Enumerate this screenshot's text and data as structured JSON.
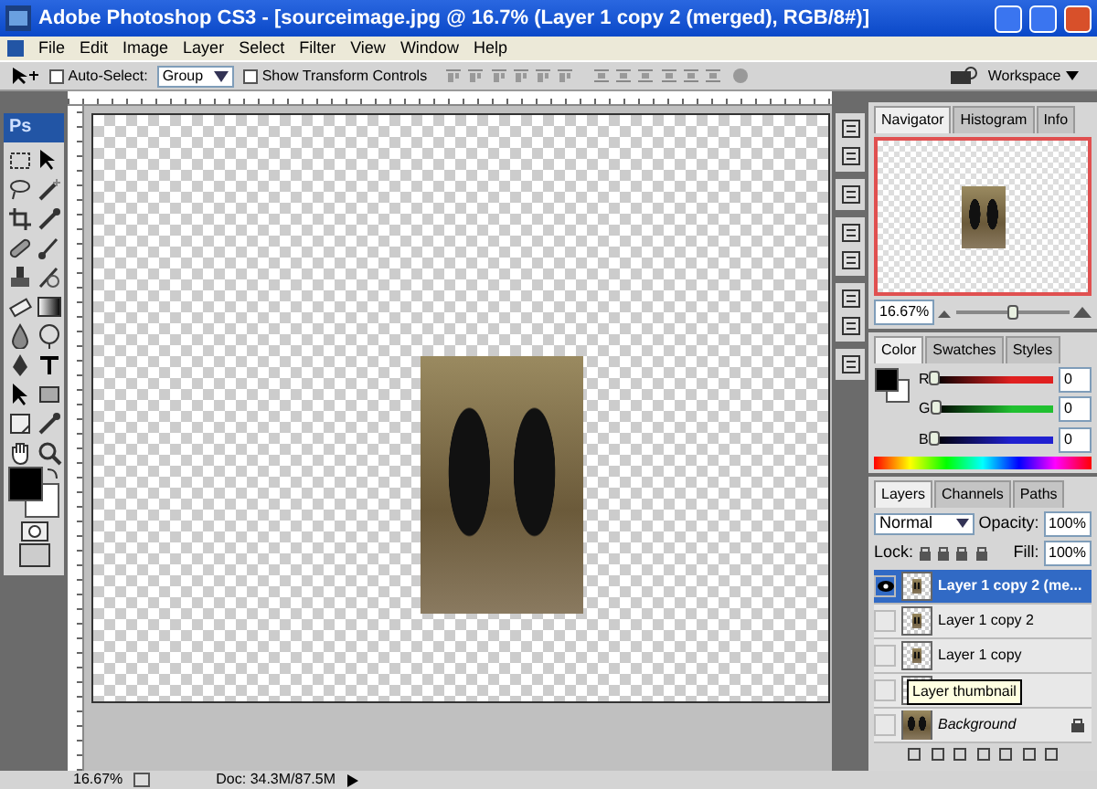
{
  "window": {
    "title": "Adobe Photoshop CS3 - [sourceimage.jpg @ 16.7% (Layer 1 copy 2 (merged), RGB/8#)]"
  },
  "menu": [
    "File",
    "Edit",
    "Image",
    "Layer",
    "Select",
    "Filter",
    "View",
    "Window",
    "Help"
  ],
  "options_bar": {
    "auto_select": {
      "label": "Auto-Select:",
      "checked": false
    },
    "auto_select_mode": "Group",
    "transform_controls": {
      "label": "Show Transform Controls",
      "checked": false
    },
    "workspace": "Workspace"
  },
  "toolbox": {
    "logo": "Ps"
  },
  "navigator": {
    "tabs": [
      {
        "label": "Navigator",
        "selected": true
      },
      {
        "label": "Histogram",
        "selected": false
      },
      {
        "label": "Info",
        "selected": false
      }
    ],
    "zoom": "16.67%",
    "level": 0.5
  },
  "color": {
    "tabs": [
      {
        "label": "Color",
        "selected": true
      },
      {
        "label": "Swatches",
        "selected": false
      },
      {
        "label": "Styles",
        "selected": false
      }
    ],
    "channels": [
      {
        "name": "R",
        "value": "0",
        "level": 0,
        "color": "#e02020"
      },
      {
        "name": "G",
        "value": "0",
        "level": 0,
        "color": "#20c030"
      },
      {
        "name": "B",
        "value": "0",
        "level": 0,
        "color": "#2020d0"
      }
    ]
  },
  "layers": {
    "tabs": [
      {
        "label": "Layers",
        "selected": true
      },
      {
        "label": "Channels",
        "selected": false
      },
      {
        "label": "Paths",
        "selected": false
      }
    ],
    "blend_mode": "Normal",
    "opacity_label": "Opacity:",
    "opacity": "100%",
    "lock_label": "Lock:",
    "fill_label": "Fill:",
    "fill": "100%",
    "rows": [
      {
        "kind": "layer",
        "name": "Layer 1 copy 2 (me...",
        "selected": true,
        "visible": true,
        "locked": false
      },
      {
        "kind": "layer",
        "name": "Layer 1 copy 2",
        "selected": false,
        "visible": false,
        "locked": false
      },
      {
        "kind": "layer",
        "name": "Layer 1 copy",
        "selected": false,
        "visible": false,
        "locked": false
      },
      {
        "kind": "layer",
        "selected": false,
        "visible": false,
        "locked": false
      },
      {
        "kind": "background",
        "name": "Background",
        "selected": false,
        "visible": false,
        "locked": true
      }
    ],
    "tooltip": "Layer thumbnail"
  },
  "status_bar": {
    "zoom": "16.67%",
    "doc": "Doc: 34.3M/87.5M"
  }
}
